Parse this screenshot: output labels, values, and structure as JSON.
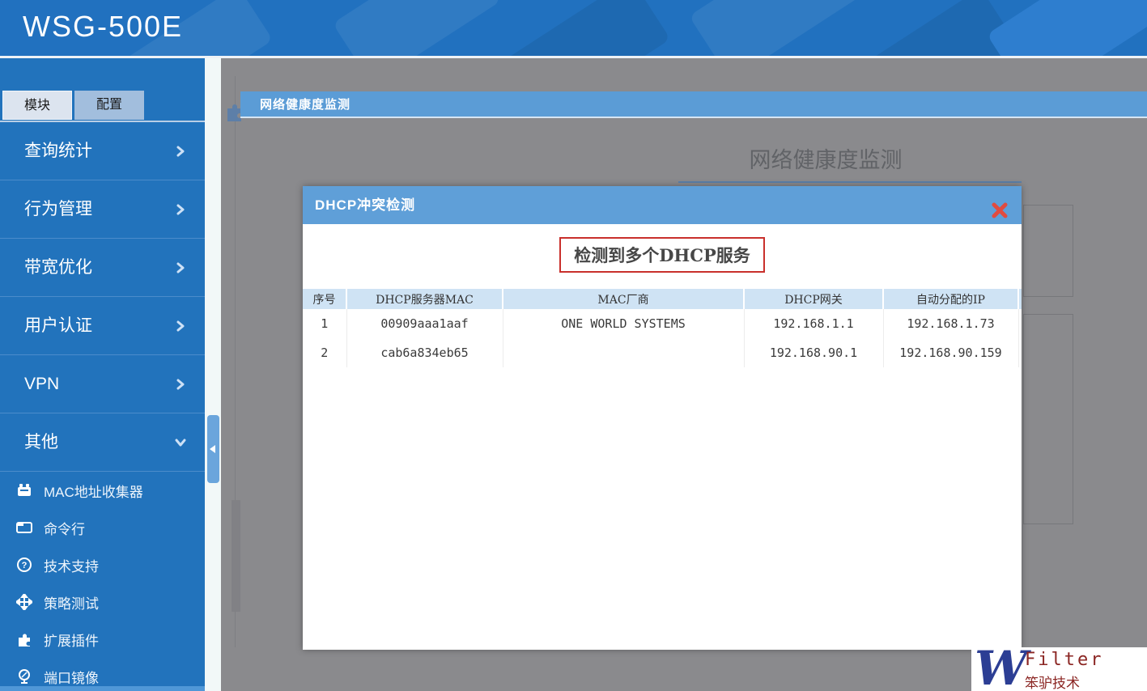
{
  "app": {
    "title": "WSG-500E"
  },
  "sidebar": {
    "tabs": [
      {
        "label": "模块",
        "active": true
      },
      {
        "label": "配置",
        "active": false
      }
    ],
    "menu": [
      {
        "label": "查询统计",
        "chevron": "right"
      },
      {
        "label": "行为管理",
        "chevron": "right"
      },
      {
        "label": "带宽优化",
        "chevron": "right"
      },
      {
        "label": "用户认证",
        "chevron": "right"
      },
      {
        "label": "VPN",
        "chevron": "right"
      },
      {
        "label": "其他",
        "chevron": "down",
        "expanded": true
      }
    ],
    "submenu": [
      {
        "label": "MAC地址收集器",
        "icon": "mac-collector-icon"
      },
      {
        "label": "命令行",
        "icon": "command-line-icon"
      },
      {
        "label": "技术支持",
        "icon": "support-icon"
      },
      {
        "label": "策略测试",
        "icon": "policy-test-icon"
      },
      {
        "label": "扩展插件",
        "icon": "plugin-icon"
      },
      {
        "label": "端口镜像",
        "icon": "port-mirror-icon"
      }
    ]
  },
  "content": {
    "header_title": "网络健康度监测",
    "dimmed_page_title": "网络健康度监测"
  },
  "modal": {
    "title": "DHCP冲突检测",
    "alert": "检测到多个DHCP服务",
    "table": {
      "columns": [
        "序号",
        "DHCP服务器MAC",
        "MAC厂商",
        "DHCP网关",
        "自动分配的IP"
      ],
      "rows": [
        [
          "1",
          "00909aaa1aaf",
          "ONE WORLD SYSTEMS",
          "192.168.1.1",
          "192.168.1.73"
        ],
        [
          "2",
          "cab6a834eb65",
          "",
          "192.168.90.1",
          "192.168.90.159"
        ]
      ]
    }
  },
  "watermark": {
    "logo_letter": "W",
    "brand": "Filter",
    "company": "笨驴技术"
  },
  "colors": {
    "banner_blue": "#2171bf",
    "sidebar_blue": "#2273bc",
    "header_bar_blue": "#5b9cd6",
    "modal_titlebar_blue": "#5f9fd8",
    "table_header_blue": "#cfe3f4",
    "alert_border_red": "#c9302c",
    "close_icon_red": "#e14b3f",
    "overlay_gray": "#8a8a8d",
    "watermark_navy": "#2c3e94",
    "watermark_red": "#8b2623"
  }
}
